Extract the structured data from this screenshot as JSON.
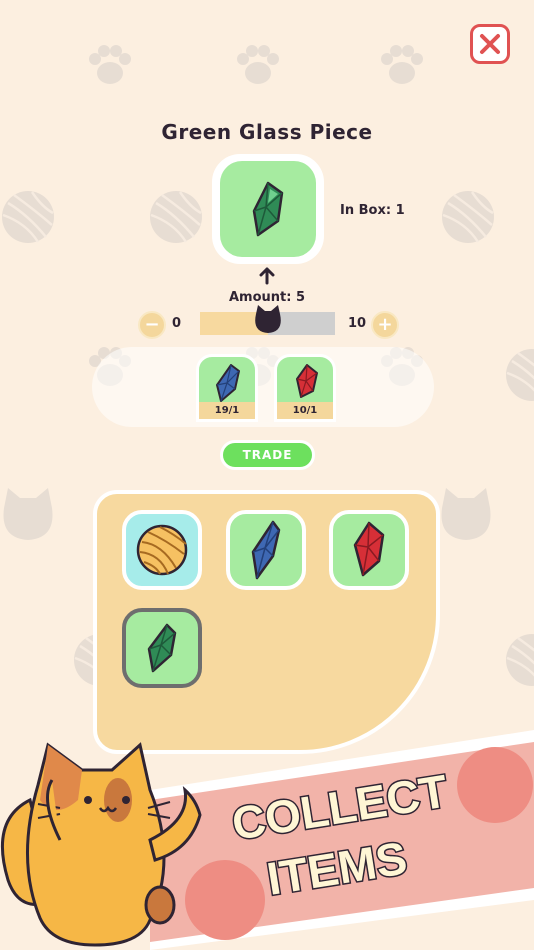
{
  "item": {
    "title": "Green Glass Piece",
    "in_box_label": "In Box: 1",
    "icon": "green-glass-piece-icon"
  },
  "amount": {
    "label": "Amount: 5",
    "min": "0",
    "max": "10",
    "current_fraction": 0.5,
    "decrease_symbol": "−",
    "increase_symbol": "+"
  },
  "recipe": [
    {
      "icon": "blue-glass-piece-icon",
      "count": "19/1"
    },
    {
      "icon": "red-glass-piece-icon",
      "count": "10/1"
    }
  ],
  "trade_label": "TRADE",
  "inventory": [
    {
      "icon": "yarn-ball-icon",
      "selected": false
    },
    {
      "icon": "blue-glass-piece-icon",
      "selected": false
    },
    {
      "icon": "red-glass-piece-icon",
      "selected": false
    },
    {
      "icon": "green-glass-piece-icon",
      "selected": true
    }
  ],
  "banner": {
    "line1": "COLLECT",
    "line2": "ITEMS"
  },
  "colors": {
    "background": "#fcefe0",
    "green_slot": "#a6eba0",
    "cyan_slot": "#a6ecea",
    "panel": "#f7d99f",
    "trade_button": "#6de05e",
    "close_red": "#e05252",
    "banner_pink": "#f2b3a9",
    "cat_orange": "#f6b746"
  }
}
